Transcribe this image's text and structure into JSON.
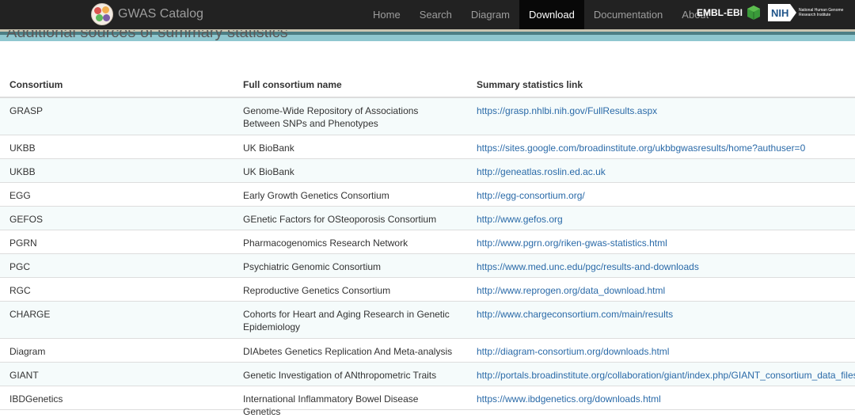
{
  "header": {
    "brand": "GWAS Catalog",
    "nav": [
      {
        "label": "Home",
        "active": false
      },
      {
        "label": "Search",
        "active": false
      },
      {
        "label": "Diagram",
        "active": false
      },
      {
        "label": "Download",
        "active": true
      },
      {
        "label": "Documentation",
        "active": false
      },
      {
        "label": "About",
        "active": false
      }
    ],
    "embl_label": "EMBL-EBI",
    "nih_label": "NIH",
    "nih_subtext": "National Human Genome Research Institute"
  },
  "section": {
    "heading": "Additional sources of summary statistics"
  },
  "table": {
    "columns": [
      "Consortium",
      "Full consortium name",
      "Summary statistics link"
    ],
    "rows": [
      {
        "consortium": "GRASP",
        "name": "Genome-Wide Repository of Associations Between SNPs and Phenotypes",
        "link": "https://grasp.nhlbi.nih.gov/FullResults.aspx"
      },
      {
        "consortium": "UKBB",
        "name": "UK BioBank",
        "link": "https://sites.google.com/broadinstitute.org/ukbbgwasresults/home?authuser=0"
      },
      {
        "consortium": "UKBB",
        "name": "UK BioBank",
        "link": "http://geneatlas.roslin.ed.ac.uk"
      },
      {
        "consortium": "EGG",
        "name": "Early Growth Genetics Consortium",
        "link": "http://egg-consortium.org/"
      },
      {
        "consortium": "GEFOS",
        "name": "GEnetic Factors for OSteoporosis Consortium",
        "link": "http://www.gefos.org"
      },
      {
        "consortium": "PGRN",
        "name": "Pharmacogenomics Research Network",
        "link": "http://www.pgrn.org/riken-gwas-statistics.html"
      },
      {
        "consortium": "PGC",
        "name": "Psychiatric Genomic Consortium",
        "link": "https://www.med.unc.edu/pgc/results-and-downloads"
      },
      {
        "consortium": "RGC",
        "name": "Reproductive Genetics Consortium",
        "link": "http://www.reprogen.org/data_download.html"
      },
      {
        "consortium": "CHARGE",
        "name": "Cohorts for Heart and Aging Research in Genetic Epidemiology",
        "link": "http://www.chargeconsortium.com/main/results"
      },
      {
        "consortium": "Diagram",
        "name": "DIAbetes Genetics Replication And Meta-analysis",
        "link": "http://diagram-consortium.org/downloads.html"
      },
      {
        "consortium": "GIANT",
        "name": "Genetic Investigation of ANthropometric Traits",
        "link": "http://portals.broadinstitute.org/collaboration/giant/index.php/GIANT_consortium_data_files"
      },
      {
        "consortium": "IBDGenetics",
        "name": "International Inflammatory Bowel Disease Genetics",
        "link": "https://www.ibdgenetics.org/downloads.html"
      }
    ]
  },
  "colors": {
    "navbar": "#222222",
    "nav_active": "#080808",
    "link": "#2a6aa8",
    "stripe": "#8fc7cf"
  }
}
